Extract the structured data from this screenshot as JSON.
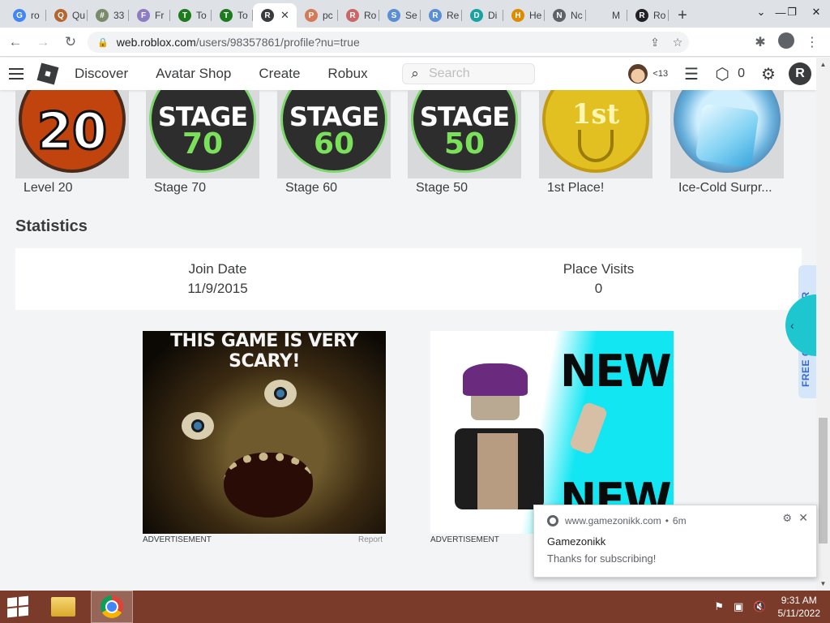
{
  "browser": {
    "tabs": [
      {
        "label": "ro",
        "fav": "G",
        "color": "#4285f4"
      },
      {
        "label": "Qu",
        "fav": "Q",
        "color": "#b5652d"
      },
      {
        "label": "33",
        "fav": "#",
        "color": "#7a8a6a"
      },
      {
        "label": "Fr",
        "fav": "F",
        "color": "#8e7cc3"
      },
      {
        "label": "To",
        "fav": "T",
        "color": "#1d7a1d"
      },
      {
        "label": "To",
        "fav": "T",
        "color": "#1d7a1d"
      },
      {
        "label": "",
        "fav": "R",
        "color": "#393b3d",
        "active": true
      },
      {
        "label": "pc",
        "fav": "P",
        "color": "#d57a57"
      },
      {
        "label": "Ro",
        "fav": "R",
        "color": "#c66"
      },
      {
        "label": "Se",
        "fav": "S",
        "color": "#5a8fd6"
      },
      {
        "label": "Re",
        "fav": "R",
        "color": "#5a8fd6"
      },
      {
        "label": "Di",
        "fav": "D",
        "color": "#18a3a3"
      },
      {
        "label": "He",
        "fav": "H",
        "color": "#e08a00"
      },
      {
        "label": "Nc",
        "fav": "N",
        "color": "#5f6368"
      },
      {
        "label": "M",
        "fav": "",
        "color": "#dee1e6"
      },
      {
        "label": "Ro",
        "fav": "R",
        "color": "#202124"
      }
    ],
    "url": {
      "domain": "web.roblox.com",
      "path": "/users/98357861/profile?nu=true"
    }
  },
  "header": {
    "nav": [
      "Discover",
      "Avatar Shop",
      "Create",
      "Robux"
    ],
    "search_placeholder": "Search",
    "age": "<13",
    "robux": "0"
  },
  "badges": [
    {
      "label": "Level 20",
      "kind": "level",
      "text": "20"
    },
    {
      "label": "Stage 70",
      "kind": "stage",
      "text": "STAGE",
      "num": "70"
    },
    {
      "label": "Stage 60",
      "kind": "stage",
      "text": "STAGE",
      "num": "60"
    },
    {
      "label": "Stage 50",
      "kind": "stage",
      "text": "STAGE",
      "num": "50"
    },
    {
      "label": "1st Place!",
      "kind": "gold",
      "text": "1st"
    },
    {
      "label": "Ice-Cold Surpr...",
      "kind": "ice"
    }
  ],
  "statistics": {
    "title": "Statistics",
    "join_date_label": "Join Date",
    "join_date": "11/9/2015",
    "place_visits_label": "Place Visits",
    "place_visits": "0"
  },
  "ads": {
    "ad1_headline": "THIS GAME IS VERY SCARY!",
    "ad2_word": "NEW",
    "label": "ADVERTISEMENT",
    "report": "Report"
  },
  "extension": {
    "label": "FREE CONVERTER"
  },
  "notification": {
    "source": "www.gamezonikk.com",
    "time": "6m",
    "title": "Gamezonikk",
    "body": "Thanks for subscribing!"
  },
  "taskbar": {
    "time": "9:31 AM",
    "date": "5/11/2022"
  }
}
